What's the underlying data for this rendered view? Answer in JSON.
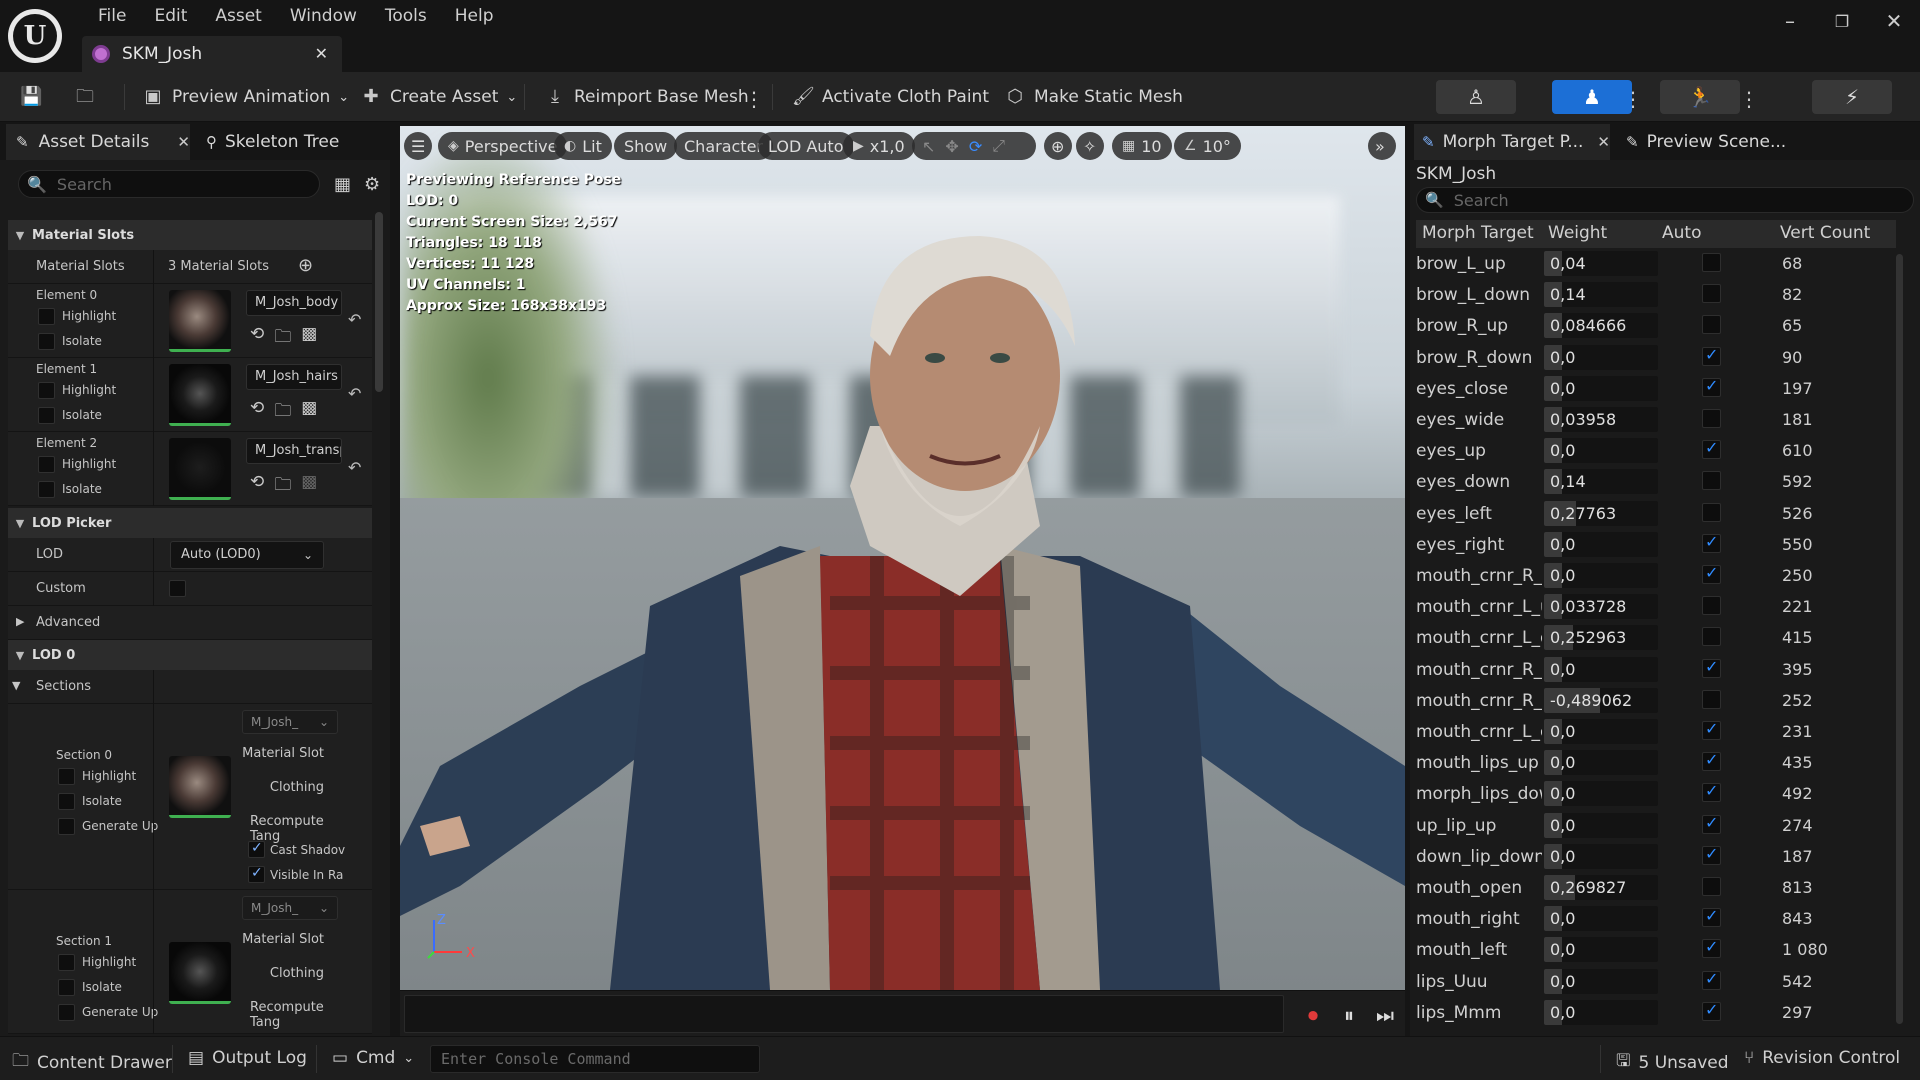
{
  "app": {
    "menu": [
      "File",
      "Edit",
      "Asset",
      "Window",
      "Tools",
      "Help"
    ],
    "document_tab": "SKM_Josh",
    "accent": "#1c6fd6"
  },
  "toolbar": {
    "preview_animation": "Preview Animation",
    "create_asset": "Create Asset",
    "reimport": "Reimport Base Mesh",
    "activate_cloth": "Activate Cloth Paint",
    "make_static": "Make Static Mesh"
  },
  "left_panel": {
    "tab_details": "Asset Details",
    "tab_skeleton": "Skeleton Tree",
    "search_placeholder": "Search",
    "material_slots": {
      "header": "Material Slots",
      "label": "Material Slots",
      "value": "3 Material Slots",
      "elements": [
        {
          "label": "Element 0",
          "highlight": "Highlight",
          "isolate": "Isolate",
          "material": "M_Josh_body"
        },
        {
          "label": "Element 1",
          "highlight": "Highlight",
          "isolate": "Isolate",
          "material": "M_Josh_hairs"
        },
        {
          "label": "Element 2",
          "highlight": "Highlight",
          "isolate": "Isolate",
          "material": "M_Josh_transp"
        }
      ]
    },
    "lod_picker": {
      "header": "LOD Picker",
      "lod_label": "LOD",
      "lod_value": "Auto (LOD0)",
      "custom_label": "Custom"
    },
    "advanced": "Advanced",
    "lod0": "LOD 0",
    "sections": {
      "header": "Sections",
      "items": [
        {
          "label": "Section 0",
          "highlight": "Highlight",
          "isolate": "Isolate",
          "generate": "Generate Up",
          "dd": "M_Josh_",
          "material_slot": "Material Slot",
          "clothing": "Clothing",
          "recompute": "Recompute Tang",
          "cast_shadow": "Cast Shadov",
          "visible": "Visible In Ra"
        },
        {
          "label": "Section 1",
          "highlight": "Highlight",
          "isolate": "Isolate",
          "generate": "Generate Up",
          "dd": "M_Josh_",
          "material_slot": "Material Slot",
          "clothing": "Clothing",
          "recompute": "Recompute Tang"
        }
      ]
    }
  },
  "viewport": {
    "perspective": "Perspective",
    "lit": "Lit",
    "show": "Show",
    "character": "Character",
    "lod": "LOD Auto",
    "speed": "x1,0",
    "grid": "10",
    "angle": "10°",
    "info": [
      "Previewing Reference Pose",
      "LOD: 0",
      "Current Screen Size: 2,567",
      "Triangles: 18 118",
      "Vertices: 11 128",
      "UV Channels: 1",
      "Approx Size: 168x38x193"
    ],
    "axis_z": "Z",
    "axis_x": "X"
  },
  "right_panel": {
    "tab_morph": "Morph Target P...",
    "tab_preview": "Preview Scene...",
    "title": "SKM_Josh",
    "search_placeholder": "Search",
    "columns": [
      "Morph Target",
      "Weight",
      "Auto",
      "Vert Count"
    ],
    "rows": [
      {
        "name": "brow_L_up",
        "weight": "0,04",
        "w": 0.04,
        "auto": false,
        "verts": "68"
      },
      {
        "name": "brow_L_down",
        "weight": "0,14",
        "w": 0.14,
        "auto": false,
        "verts": "82"
      },
      {
        "name": "brow_R_up",
        "weight": "0,084666",
        "w": 0.084666,
        "auto": false,
        "verts": "65"
      },
      {
        "name": "brow_R_down",
        "weight": "0,0",
        "w": 0.0,
        "auto": true,
        "verts": "90"
      },
      {
        "name": "eyes_close",
        "weight": "0,0",
        "w": 0.0,
        "auto": true,
        "verts": "197"
      },
      {
        "name": "eyes_wide",
        "weight": "0,03958",
        "w": 0.03958,
        "auto": false,
        "verts": "181"
      },
      {
        "name": "eyes_up",
        "weight": "0,0",
        "w": 0.0,
        "auto": true,
        "verts": "610"
      },
      {
        "name": "eyes_down",
        "weight": "0,14",
        "w": 0.14,
        "auto": false,
        "verts": "592"
      },
      {
        "name": "eyes_left",
        "weight": "0,27763",
        "w": 0.27763,
        "auto": false,
        "verts": "526"
      },
      {
        "name": "eyes_right",
        "weight": "0,0",
        "w": 0.0,
        "auto": true,
        "verts": "550"
      },
      {
        "name": "mouth_crnr_R_u",
        "weight": "0,0",
        "w": 0.0,
        "auto": true,
        "verts": "250"
      },
      {
        "name": "mouth_crnr_L_u",
        "weight": "0,033728",
        "w": 0.033728,
        "auto": false,
        "verts": "221"
      },
      {
        "name": "mouth_crnr_L_d",
        "weight": "0,252963",
        "w": 0.252963,
        "auto": false,
        "verts": "415"
      },
      {
        "name": "mouth_crnr_R_d",
        "weight": "0,0",
        "w": 0.0,
        "auto": true,
        "verts": "395"
      },
      {
        "name": "mouth_crnr_R_o",
        "weight": "-0,489062",
        "w": -0.489062,
        "auto": false,
        "verts": "252"
      },
      {
        "name": "mouth_crnr_L_o",
        "weight": "0,0",
        "w": 0.0,
        "auto": true,
        "verts": "231"
      },
      {
        "name": "mouth_lips_up",
        "weight": "0,0",
        "w": 0.0,
        "auto": true,
        "verts": "435"
      },
      {
        "name": "morph_lips_down",
        "weight": "0,0",
        "w": 0.0,
        "auto": true,
        "verts": "492"
      },
      {
        "name": "up_lip_up",
        "weight": "0,0",
        "w": 0.0,
        "auto": true,
        "verts": "274"
      },
      {
        "name": "down_lip_down",
        "weight": "0,0",
        "w": 0.0,
        "auto": true,
        "verts": "187"
      },
      {
        "name": "mouth_open",
        "weight": "0,269827",
        "w": 0.269827,
        "auto": false,
        "verts": "813"
      },
      {
        "name": "mouth_right",
        "weight": "0,0",
        "w": 0.0,
        "auto": true,
        "verts": "843"
      },
      {
        "name": "mouth_left",
        "weight": "0,0",
        "w": 0.0,
        "auto": true,
        "verts": "1 080"
      },
      {
        "name": "lips_Uuu",
        "weight": "0,0",
        "w": 0.0,
        "auto": true,
        "verts": "542"
      },
      {
        "name": "lips_Mmm",
        "weight": "0,0",
        "w": 0.0,
        "auto": true,
        "verts": "297"
      }
    ]
  },
  "statusbar": {
    "content_drawer": "Content Drawer",
    "output_log": "Output Log",
    "cmd": "Cmd",
    "console_placeholder": "Enter Console Command",
    "unsaved": "5 Unsaved",
    "revision": "Revision Control"
  }
}
